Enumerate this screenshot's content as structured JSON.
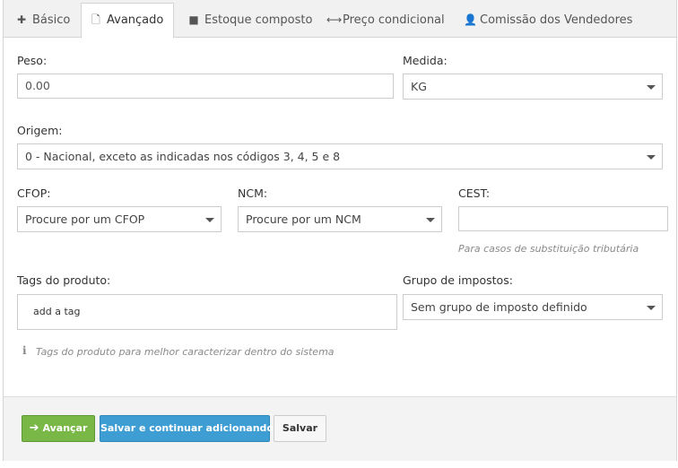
{
  "tabs": [
    {
      "icon": "plus-icon",
      "glyph": "✚",
      "label": "Básico"
    },
    {
      "icon": "document-icon",
      "glyph": "🗋",
      "label": "Avançado"
    },
    {
      "icon": "stack-icon",
      "glyph": "■",
      "label": "Estoque composto"
    },
    {
      "icon": "arrows-horizontal-icon",
      "glyph": "⟷",
      "label": "Preço condicional"
    },
    {
      "icon": "user-icon",
      "glyph": "👤",
      "label": "Comissão dos Vendedores"
    }
  ],
  "active_tab": "Avançado",
  "form": {
    "peso": {
      "label": "Peso:",
      "value": "0.00"
    },
    "medida": {
      "label": "Medida:",
      "value": "KG"
    },
    "origem": {
      "label": "Origem:",
      "value": "0 - Nacional, exceto as indicadas nos códigos 3, 4, 5 e 8"
    },
    "cfop": {
      "label": "CFOP:",
      "placeholder": "Procure por um CFOP"
    },
    "ncm": {
      "label": "NCM:",
      "placeholder": "Procure por um NCM"
    },
    "cest": {
      "label": "CEST:",
      "value": "",
      "hint": "Para casos de substituição tributária"
    },
    "tags": {
      "label": "Tags do produto:",
      "placeholder": "add a tag",
      "hint": "Tags do produto para melhor caracterizar dentro do sistema"
    },
    "grupo_impostos": {
      "label": "Grupo de impostos:",
      "value": "Sem grupo de imposto definido"
    }
  },
  "footer": {
    "advance_label": "Avançar",
    "save_continue_label": "Salvar e continuar adicionando",
    "save_label": "Salvar"
  },
  "colors": {
    "advance_button": "#79b846",
    "save_continue_button": "#3e9ed3",
    "tabs_background": "#f1f1f1",
    "footer_background": "#f3f3f3"
  }
}
